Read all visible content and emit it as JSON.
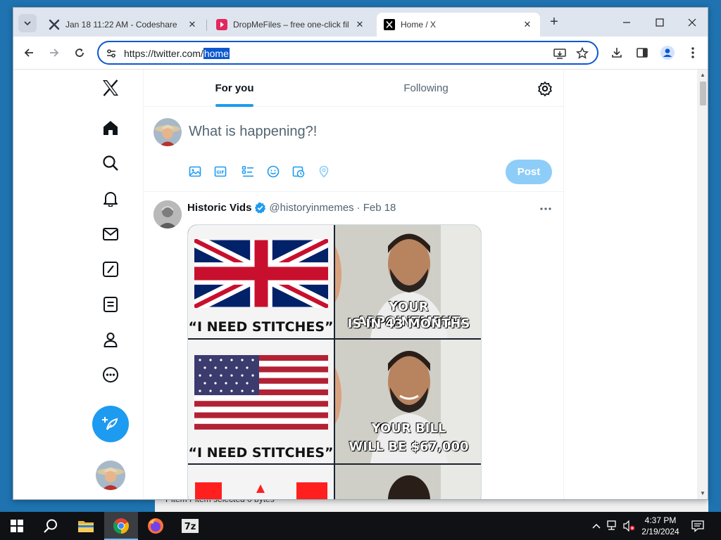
{
  "browser": {
    "tabs": [
      {
        "title": "Jan 18 11:22 AM - Codeshare",
        "active": false
      },
      {
        "title": "DropMeFiles – free one-click fil",
        "active": false
      },
      {
        "title": "Home / X",
        "active": true
      }
    ],
    "url_prefix": "https://twitter.com/",
    "url_selected": "home"
  },
  "x": {
    "tabs": {
      "for_you": "For you",
      "following": "Following"
    },
    "composer": {
      "placeholder": "What is happening?!",
      "post_label": "Post"
    },
    "tweet": {
      "name": "Historic Vids",
      "handle": "@historyinmemes",
      "separator": "·",
      "date": "Feb 18",
      "meme": {
        "row1_left": "“I NEED STITCHES”",
        "row1_right_line1": "YOUR APPOINTMENT",
        "row1_right_line2": "IS IN 43 MONTHS",
        "row2_left": "“I NEED STITCHES”",
        "row2_right_line1": "YOUR BILL",
        "row2_right_line2": "WILL BE $67,000"
      }
    }
  },
  "background_window": {
    "status": "Pitem    Pitem selected  0 bytes"
  },
  "taskbar": {
    "time": "4:37 PM",
    "date": "2/19/2024",
    "items": [
      "start-icon",
      "search-icon",
      "file-explorer-icon",
      "chrome-icon",
      "firefox-icon",
      "7zip-icon"
    ]
  },
  "colors": {
    "x_blue": "#1d9bf0",
    "post_disabled": "#8ecdf8",
    "omnibox_border": "#0b57d0"
  }
}
